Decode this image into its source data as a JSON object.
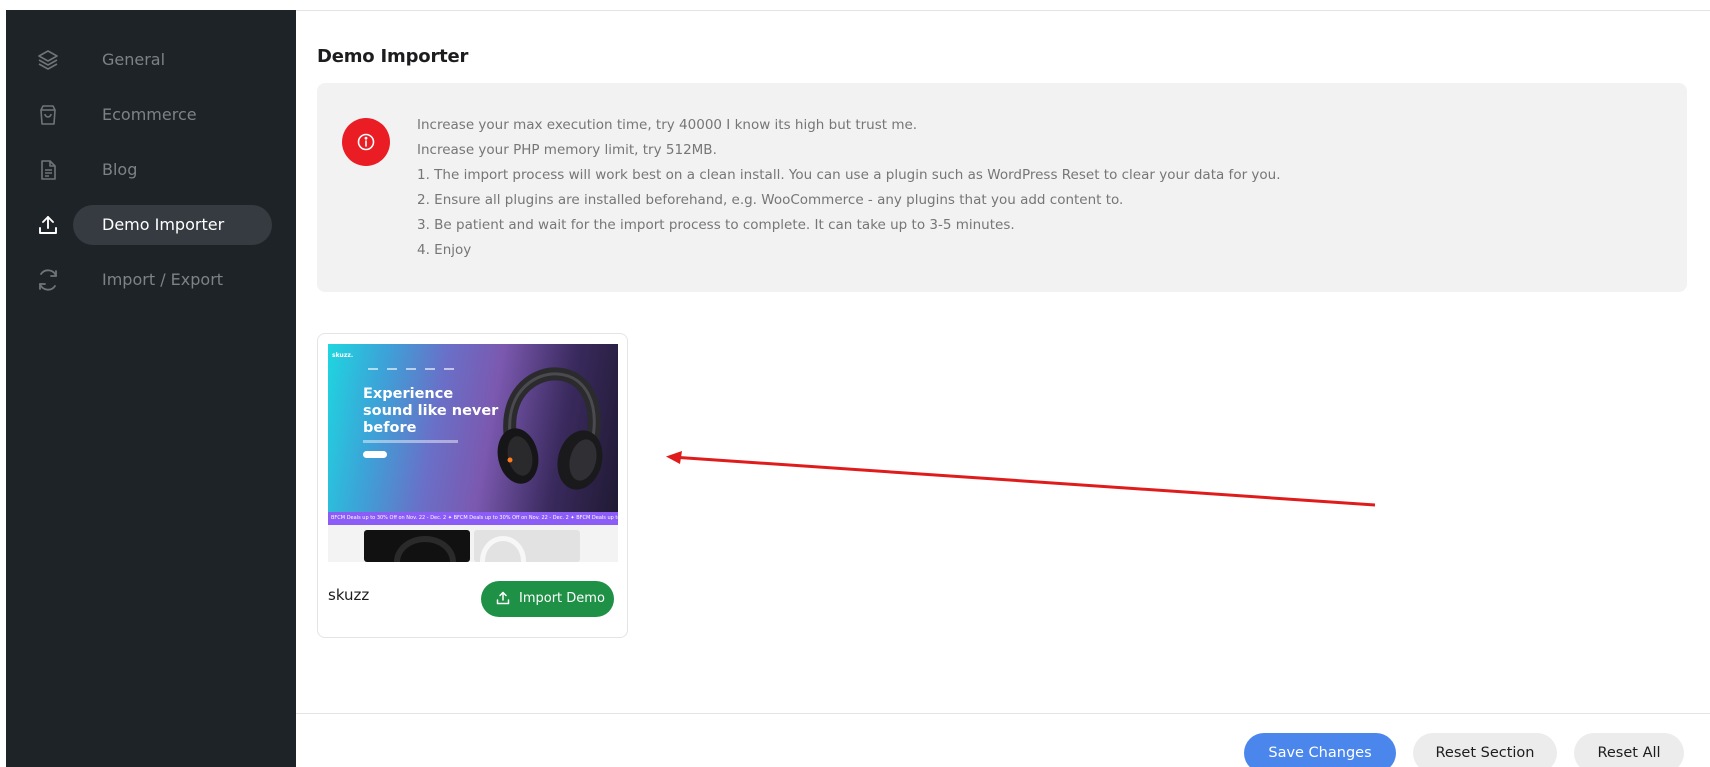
{
  "sidebar": {
    "items": [
      {
        "label": "General",
        "icon": "layers-icon",
        "active": false
      },
      {
        "label": "Ecommerce",
        "icon": "shopping-bag-icon",
        "active": false
      },
      {
        "label": "Blog",
        "icon": "document-icon",
        "active": false
      },
      {
        "label": "Demo Importer",
        "icon": "upload-icon",
        "active": true
      },
      {
        "label": "Import / Export",
        "icon": "refresh-icon",
        "active": false
      }
    ]
  },
  "main": {
    "title": "Demo Importer",
    "notice": {
      "icon": "info-icon",
      "icon_color": "#ea1c24",
      "lines": [
        "Increase your max execution time, try 40000 I know its high but trust me.",
        "Increase your PHP memory limit, try 512MB.",
        "1. The import process will work best on a clean install. You can use a plugin such as WordPress Reset to clear your data for you.",
        "2. Ensure all plugins are installed beforehand, e.g. WooCommerce - any plugins that you add content to.",
        "3. Be patient and wait for the import process to complete. It can take up to 3-5 minutes.",
        "4. Enjoy"
      ]
    },
    "demos": [
      {
        "name": "skuzz",
        "button_label": "Import Demo",
        "preview": {
          "logo": "skuzz.",
          "headline": "Experience sound like never before",
          "promo": "BFCM Deals up to 30% Off on Nov. 22 - Dec. 2  ✦  BFCM Deals up to 30% Off on Nov. 22 - Dec. 2  ✦  BFCM Deals up to 30% Off o"
        }
      }
    ]
  },
  "footer": {
    "save_label": "Save Changes",
    "reset_section_label": "Reset Section",
    "reset_all_label": "Reset All"
  },
  "colors": {
    "sidebar_bg": "#1e2327",
    "accent_blue": "#4a86ec",
    "import_green": "#1f9146",
    "annotation_arrow": "#e01b1b"
  }
}
